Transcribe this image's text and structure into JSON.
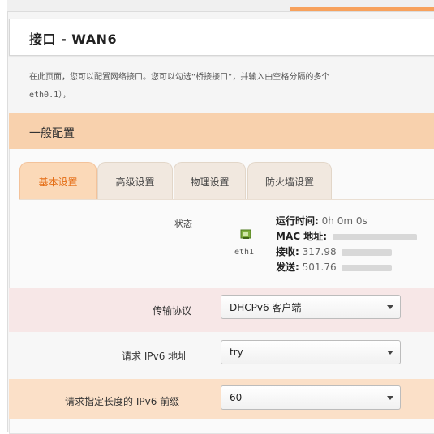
{
  "page": {
    "title": "接口 - WAN6",
    "description_line1": "在此页面，您可以配置网络接口。您可以勾选“桥接接口”，并输入由空格分隔的多个",
    "description_line2": "eth0.1），"
  },
  "section": {
    "title": "一般配置"
  },
  "tabs": [
    {
      "label": "基本设置",
      "active": true
    },
    {
      "label": "高级设置",
      "active": false
    },
    {
      "label": "物理设置",
      "active": false
    },
    {
      "label": "防火墙设置",
      "active": false
    }
  ],
  "status": {
    "label": "状态",
    "interface": "eth1",
    "uptime_label": "运行时间:",
    "uptime_value": "0h 0m 0s",
    "mac_label": "MAC 地址:",
    "rx_label": "接收:",
    "rx_value": "317.98",
    "tx_label": "发送:",
    "tx_value": "501.76"
  },
  "form": {
    "protocol_label": "传输协议",
    "protocol_value": "DHCPv6 客户端",
    "request_ipv6_label": "请求 IPv6 地址",
    "request_ipv6_value": "try",
    "prefix_label": "请求指定长度的 IPv6 前缀",
    "prefix_value": "60"
  },
  "colors": {
    "accent": "#f7a15c",
    "active_tab_text": "#e46b12",
    "section_head": "#f8d1ad"
  },
  "icons": {
    "interface": "ethernet-port-icon",
    "dropdown": "chevron-down-icon"
  }
}
